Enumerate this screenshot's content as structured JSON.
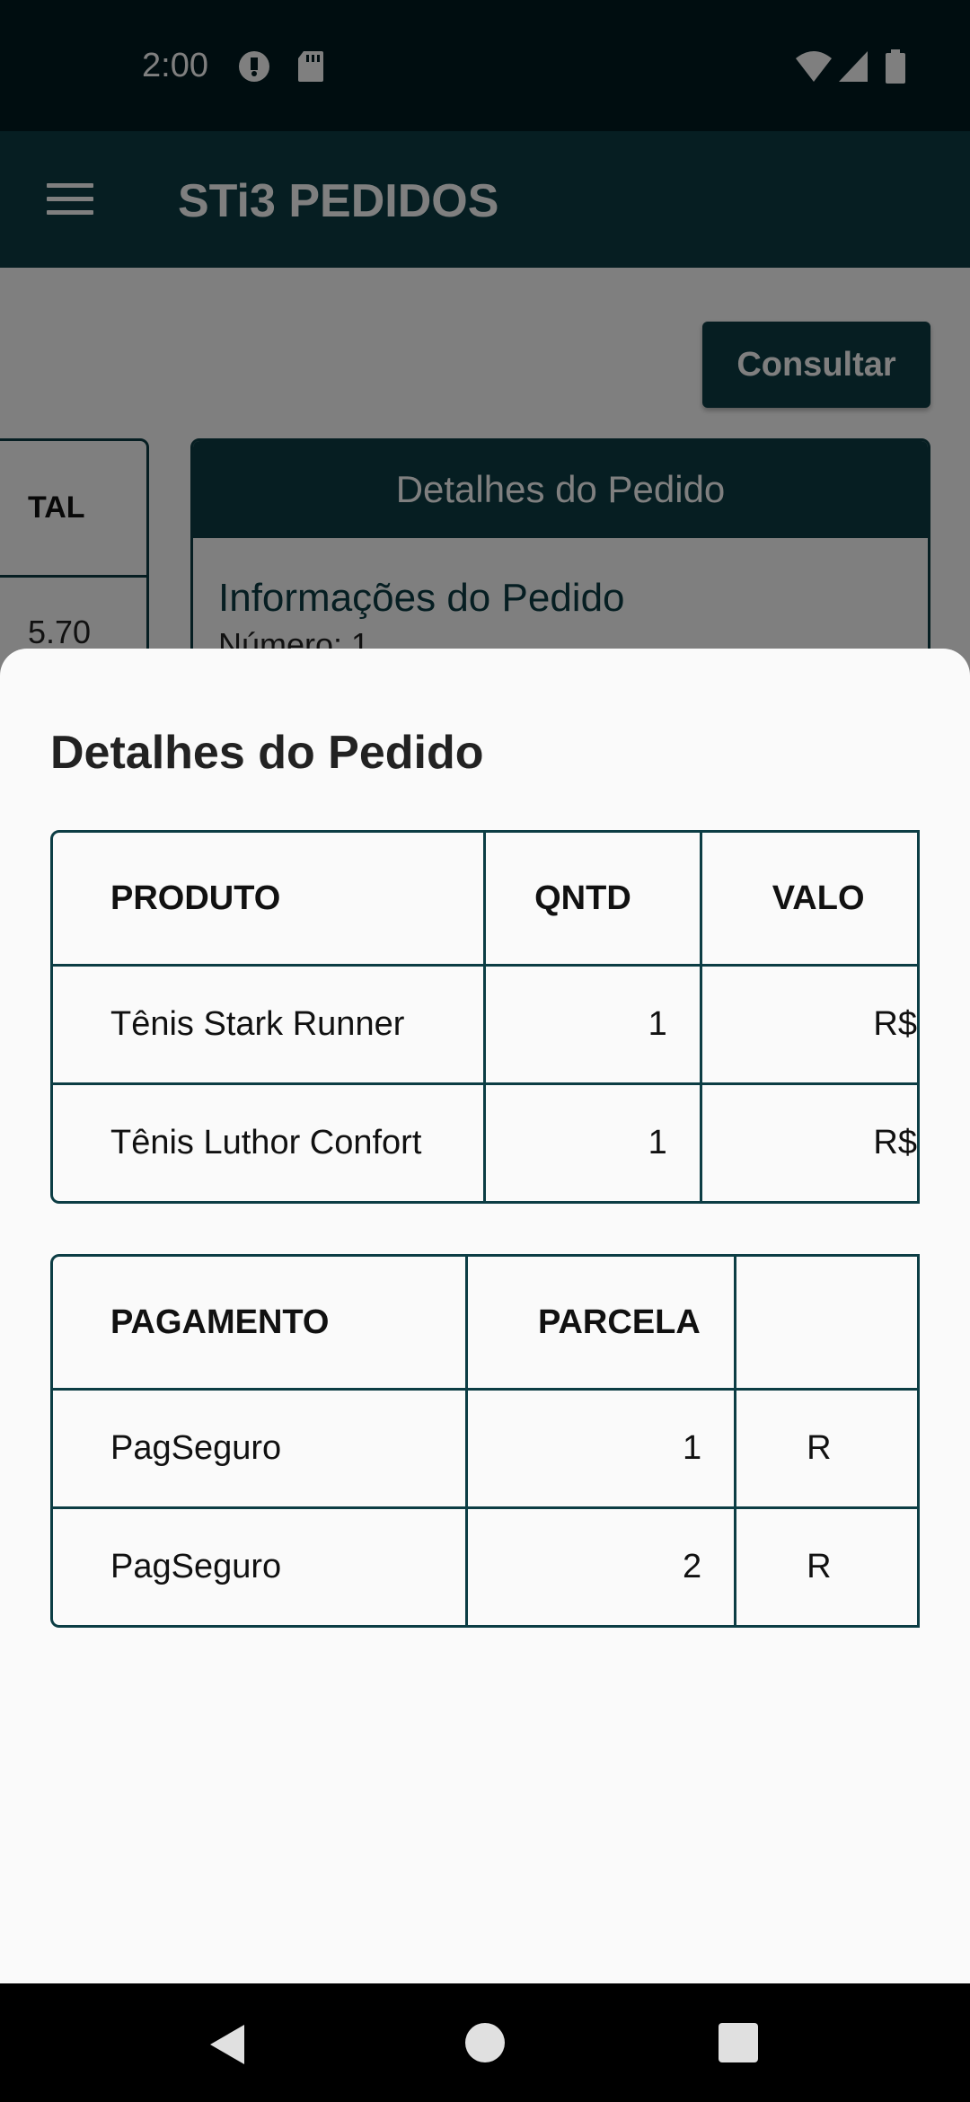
{
  "status": {
    "time": "2:00"
  },
  "app_bar": {
    "title": "STi3 PEDIDOS"
  },
  "background": {
    "consultar_label": "Consultar",
    "left_card": {
      "header": "TAL",
      "value": "5.70"
    },
    "details_card": {
      "header": "Detalhes do Pedido",
      "subtitle": "Informações do Pedido",
      "number_line": "Número: 1"
    }
  },
  "sheet": {
    "title": "Detalhes do Pedido",
    "products": {
      "headers": [
        "PRODUTO",
        "QNTD",
        "VALO"
      ],
      "rows": [
        {
          "produto": "Tênis Stark Runner",
          "qntd": "1",
          "valor": "R$"
        },
        {
          "produto": "Tênis Luthor Confort",
          "qntd": "1",
          "valor": "R$"
        }
      ]
    },
    "payments": {
      "headers": [
        "PAGAMENTO",
        "PARCELA",
        ""
      ],
      "rows": [
        {
          "pagamento": "PagSeguro",
          "parcela": "1",
          "valor": "R"
        },
        {
          "pagamento": "PagSeguro",
          "parcela": "2",
          "valor": "R"
        }
      ]
    }
  },
  "colors": {
    "primary": "#0c3d44",
    "status_bar": "#011b20",
    "sheet_bg": "#fafafa"
  }
}
